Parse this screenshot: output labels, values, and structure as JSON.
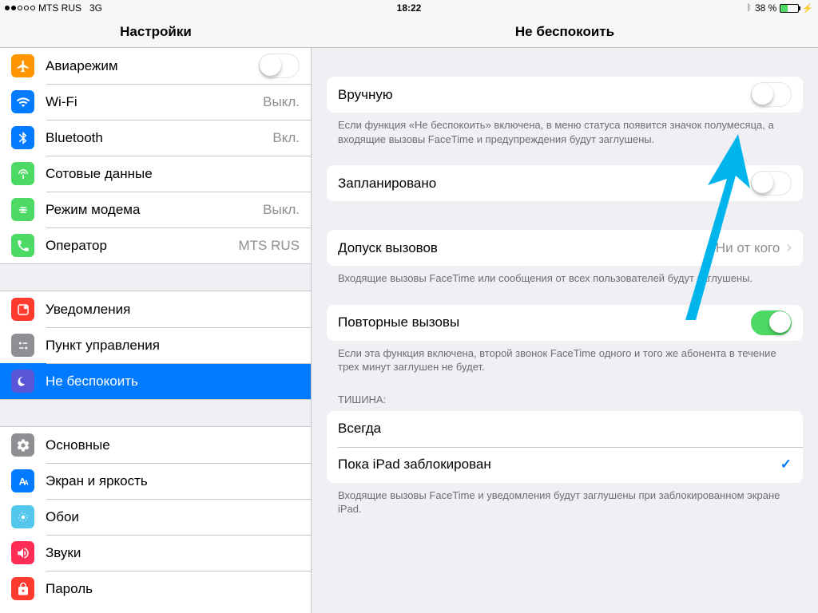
{
  "status": {
    "carrier": "MTS RUS",
    "network": "3G",
    "time": "18:22",
    "battery_pct": "38 %"
  },
  "headers": {
    "left": "Настройки",
    "right": "Не беспокоить"
  },
  "sidebar": {
    "groups": [
      [
        {
          "id": "airplane",
          "label": "Авиарежим",
          "value": "",
          "color": "#ff9500",
          "toggle": false
        },
        {
          "id": "wifi",
          "label": "Wi-Fi",
          "value": "Выкл.",
          "color": "#007aff"
        },
        {
          "id": "bluetooth",
          "label": "Bluetooth",
          "value": "Вкл.",
          "color": "#007aff"
        },
        {
          "id": "cellular",
          "label": "Сотовые данные",
          "value": "",
          "color": "#4cd964"
        },
        {
          "id": "hotspot",
          "label": "Режим модема",
          "value": "Выкл.",
          "color": "#4cd964"
        },
        {
          "id": "carrier",
          "label": "Оператор",
          "value": "MTS RUS",
          "color": "#4cd964"
        }
      ],
      [
        {
          "id": "notifications",
          "label": "Уведомления",
          "value": "",
          "color": "#ff3b30"
        },
        {
          "id": "controlcenter",
          "label": "Пункт управления",
          "value": "",
          "color": "#8e8e93"
        },
        {
          "id": "dnd",
          "label": "Не беспокоить",
          "value": "",
          "color": "#5856d6",
          "selected": true
        }
      ],
      [
        {
          "id": "general",
          "label": "Основные",
          "value": "",
          "color": "#8e8e93"
        },
        {
          "id": "display",
          "label": "Экран и яркость",
          "value": "",
          "color": "#007aff"
        },
        {
          "id": "wallpaper",
          "label": "Обои",
          "value": "",
          "color": "#54c7ec"
        },
        {
          "id": "sounds",
          "label": "Звуки",
          "value": "",
          "color": "#ff2d55"
        },
        {
          "id": "passcode",
          "label": "Пароль",
          "value": "",
          "color": "#ff3b30"
        }
      ]
    ]
  },
  "detail": {
    "manual_label": "Вручную",
    "manual_on": false,
    "manual_footer": "Если функция «Не беспокоить» включена, в меню статуса появится значок полумесяца, а входящие вызовы FaceTime и предупреждения будут заглушены.",
    "scheduled_label": "Запланировано",
    "scheduled_on": false,
    "allow_label": "Допуск вызовов",
    "allow_value": "Ни от кого",
    "allow_footer": "Входящие вызовы FaceTime или сообщения от всех пользователей будут заглушены.",
    "repeat_label": "Повторные вызовы",
    "repeat_on": true,
    "repeat_footer": "Если эта функция включена, второй звонок FaceTime одного и того же абонента в течение трех минут заглушен не будет.",
    "silence_header": "Тишина:",
    "silence_opts": [
      "Всегда",
      "Пока iPad заблокирован"
    ],
    "silence_selected": 1,
    "silence_footer": "Входящие вызовы FaceTime и уведомления будут заглушены при заблокированном экране iPad."
  }
}
